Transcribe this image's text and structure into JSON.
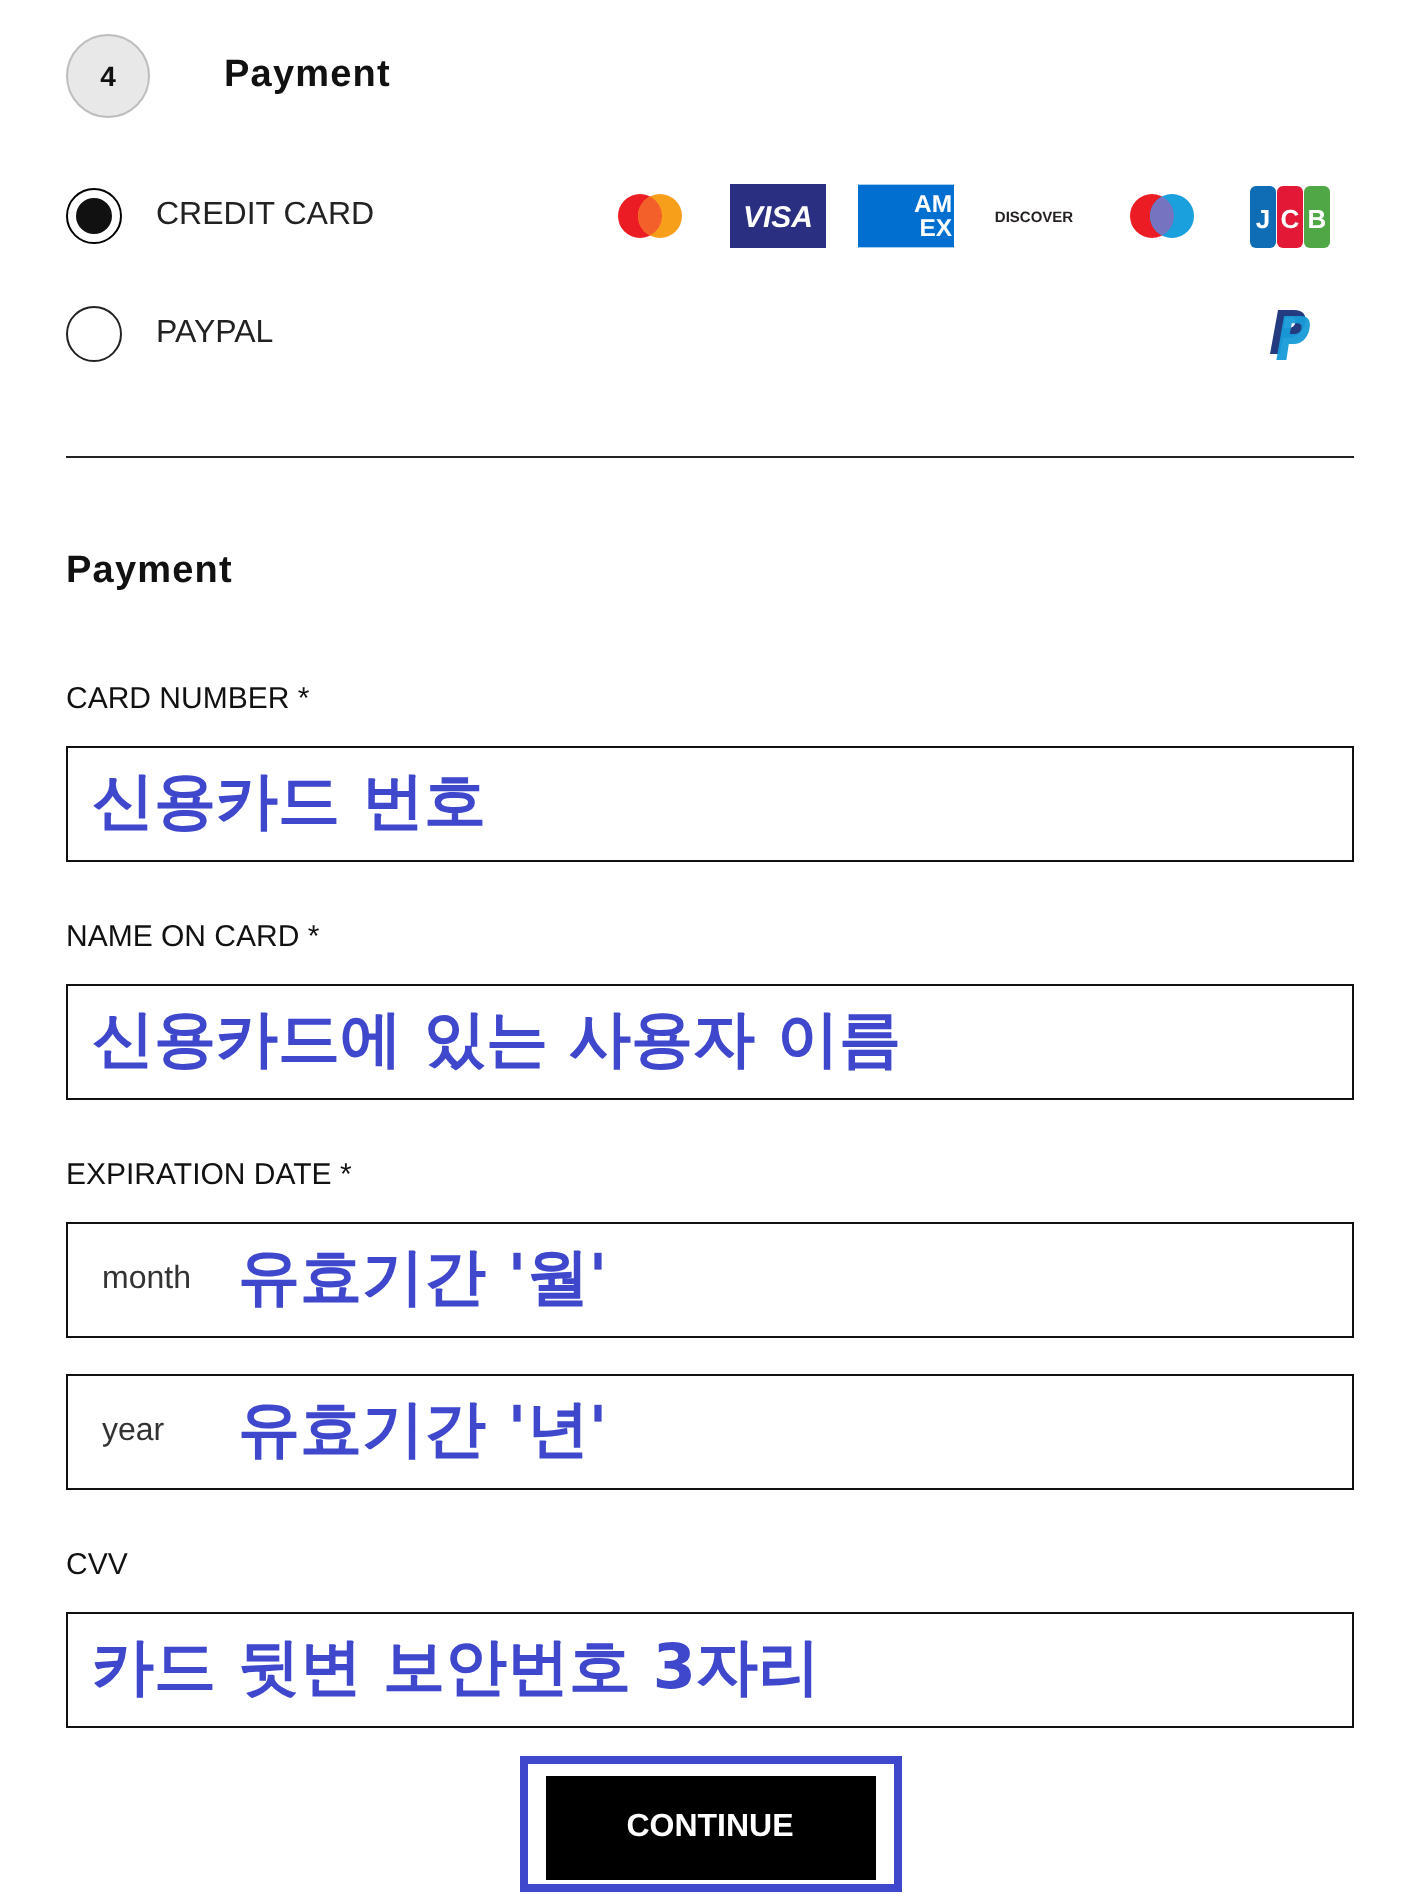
{
  "step": {
    "number": "4",
    "title": "Payment"
  },
  "payment_methods": [
    {
      "label": "CREDIT CARD",
      "selected": true,
      "logos": [
        {
          "kind": "mastercard"
        },
        {
          "kind": "visa",
          "lines": [
            "VISA"
          ]
        },
        {
          "kind": "amex",
          "lines": [
            "AM",
            "EX"
          ]
        },
        {
          "kind": "discover",
          "lines": [
            "DISCOVER"
          ]
        },
        {
          "kind": "maestro"
        },
        {
          "kind": "jcb",
          "lines": [
            "JCB"
          ]
        }
      ]
    },
    {
      "label": "PAYPAL",
      "selected": false,
      "logos": [
        {
          "kind": "paypal"
        }
      ]
    }
  ],
  "section_title": "Payment",
  "fields": [
    {
      "label": "CARD NUMBER *",
      "inputs": [
        {
          "annotation": "신용카드 번호"
        }
      ]
    },
    {
      "label": "NAME ON CARD *",
      "inputs": [
        {
          "annotation": "신용카드에 있는 사용자 이름"
        }
      ]
    },
    {
      "label": "EXPIRATION DATE *",
      "inputs": [
        {
          "placeholder": "month",
          "annotation": "유효기간 '월'"
        },
        {
          "placeholder": "year",
          "annotation": "유효기간 '년'"
        }
      ]
    },
    {
      "label": "CVV",
      "inputs": [
        {
          "annotation": "카드 뒷변 보안번호 3자리"
        }
      ]
    }
  ],
  "continue_button": {
    "label": "CONTINUE",
    "highlighted": true
  }
}
